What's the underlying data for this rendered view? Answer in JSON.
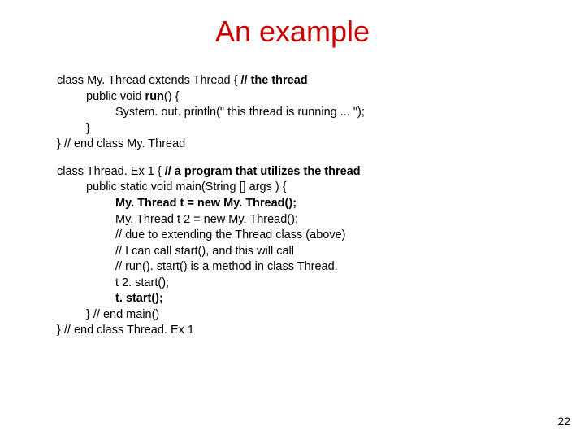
{
  "title": "An example",
  "page_number": "22",
  "block1": {
    "l1a": "class My. Thread extends Thread {           ",
    "l1b": "// the thread",
    "l2a": "public void ",
    "l2b": "run",
    "l2c": "() {",
    "l3": "System. out. println(\" this thread is running ... \");",
    "l4": "}",
    "l5": "} // end class My. Thread"
  },
  "block2": {
    "l1a": "class Thread. Ex 1 {                   ",
    "l1b": "// a program that utilizes the thread",
    "l2": "public static void main(String [] args  ) {",
    "l3": "My. Thread t = new My. Thread();",
    "l4": "My. Thread t 2 = new My. Thread();",
    "l5": "// due to extending the Thread class (above)",
    "l6": "// I can call start(), and this will call",
    "l7": "// run(). start() is a method in class Thread.",
    "l8": "t 2. start();",
    "l9": "t. start();",
    "l10": "} // end main()",
    "l11a": "}       ",
    "l11b": "// end class Thread. Ex 1"
  }
}
